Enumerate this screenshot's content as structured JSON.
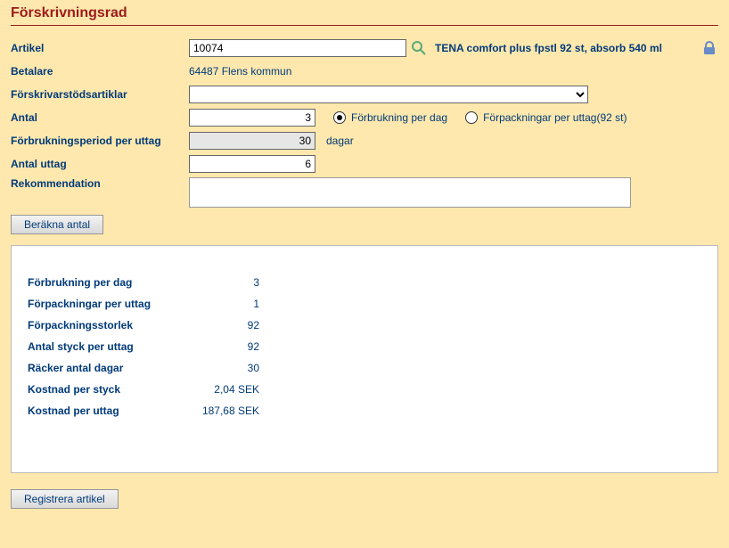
{
  "title": "Förskrivningsrad",
  "form": {
    "artikel": {
      "label": "Artikel",
      "value": "10074",
      "description": "TENA comfort plus fpstl 92 st, absorb 540 ml"
    },
    "betalare": {
      "label": "Betalare",
      "value": "64487 Flens kommun"
    },
    "forskrivarstod": {
      "label": "Förskrivarstödsartiklar",
      "value": ""
    },
    "antal": {
      "label": "Antal",
      "value": "3",
      "radio1": "Förbrukning per dag",
      "radio2": "Förpackningar per uttag(92 st)"
    },
    "period": {
      "label": "Förbrukningsperiod per uttag",
      "value": "30",
      "unit": "dagar"
    },
    "antal_uttag": {
      "label": "Antal uttag",
      "value": "6"
    },
    "rekommendation": {
      "label": "Rekommendation",
      "value": ""
    },
    "berakna": "Beräkna antal",
    "registrera": "Registrera artikel"
  },
  "summary": {
    "rows": [
      {
        "label": "Förbrukning per dag",
        "value": "3"
      },
      {
        "label": "Förpackningar per uttag",
        "value": "1"
      },
      {
        "label": "Förpackningsstorlek",
        "value": "92"
      },
      {
        "label": "Antal styck per uttag",
        "value": "92"
      },
      {
        "label": "Räcker antal dagar",
        "value": "30"
      },
      {
        "label": "Kostnad per styck",
        "value": "2,04 SEK"
      },
      {
        "label": "Kostnad per uttag",
        "value": "187,68 SEK"
      }
    ]
  }
}
